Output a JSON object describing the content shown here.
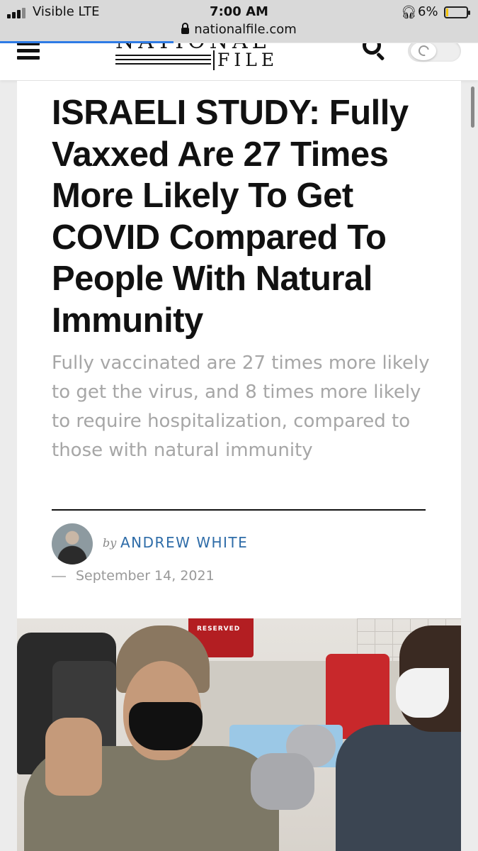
{
  "status_bar": {
    "carrier": "Visible  LTE",
    "time": "7:00 AM",
    "battery_percent": "6%",
    "url": "nationalfile.com",
    "signal_icon": "signal-bars-icon",
    "headphones_icon": "headphones-icon",
    "lock_icon": "lock-icon"
  },
  "site_header": {
    "logo_top": "NATIONAL",
    "logo_bottom": "FILE",
    "menu_icon": "hamburger-menu-icon",
    "search_icon": "search-icon",
    "dark_mode_icon": "moon-icon"
  },
  "article": {
    "headline": "ISRAELI STUDY: Fully Vaxxed Are 27 Times More Likely To Get COVID Compared To People With Natural Immunity",
    "subheadline": "Fully vaccinated are 27 times more likely to get the virus, and 8 times more likely to require hospitalization, compared to those with natural immunity",
    "byline_prefix": "by",
    "author": "ANDREW WHITE",
    "date": "September 14, 2021"
  },
  "photo": {
    "sign_text": "RESERVED"
  },
  "colors": {
    "author_link": "#2e6ca8",
    "subheadline": "#a6a6a6",
    "load_bar": "#2e7be6"
  }
}
